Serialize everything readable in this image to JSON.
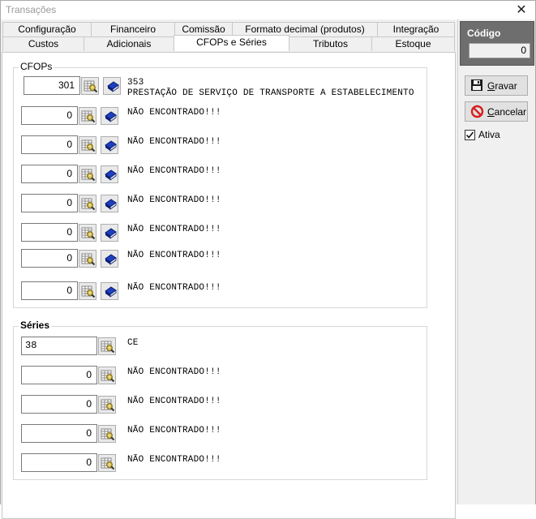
{
  "window": {
    "title": "Transações",
    "close_glyph": "✕"
  },
  "tabs": {
    "row1": [
      "Configuração",
      "Financeiro",
      "Comissão",
      "Formato decimal (produtos)",
      "Integração"
    ],
    "row2": [
      "Custos",
      "Adicionais",
      "CFOPs e Séries",
      "Tributos",
      "Estoque"
    ],
    "active": "CFOPs e Séries"
  },
  "cfops": {
    "label": "CFOPs",
    "rows": [
      {
        "value": "301",
        "line1": "353",
        "line2": "PRESTAÇÃO DE SERVIÇO DE TRANSPORTE A ESTABELECIMENTO"
      },
      {
        "value": "0",
        "line1": "NÃO ENCONTRADO!!!"
      },
      {
        "value": "0",
        "line1": "NÃO ENCONTRADO!!!"
      },
      {
        "value": "0",
        "line1": "NÃO ENCONTRADO!!!"
      },
      {
        "value": "0",
        "line1": "NÃO ENCONTRADO!!!"
      },
      {
        "value": "0",
        "line1": "NÃO ENCONTRADO!!!"
      },
      {
        "value": "0",
        "line1": "NÃO ENCONTRADO!!!"
      },
      {
        "value": "0",
        "line1": "NÃO ENCONTRADO!!!"
      }
    ]
  },
  "series": {
    "label": "Séries",
    "rows": [
      {
        "value": "38",
        "line1": "CE"
      },
      {
        "value": "0",
        "line1": "NÃO ENCONTRADO!!!"
      },
      {
        "value": "0",
        "line1": "NÃO ENCONTRADO!!!"
      },
      {
        "value": "0",
        "line1": "NÃO ENCONTRADO!!!"
      },
      {
        "value": "0",
        "line1": "NÃO ENCONTRADO!!!"
      }
    ]
  },
  "side": {
    "codigo_label": "Código",
    "codigo_value": "0",
    "gravar_label": "Gravar",
    "cancelar_label": "Cancelar",
    "ativa_label": "Ativa",
    "ativa_checked": true
  },
  "icons": {
    "search": "search-table-icon",
    "book": "blue-book-icon",
    "save": "floppy-disk-icon",
    "cancel": "cancel-circle-icon"
  },
  "colors": {
    "codigo_bg": "#6e6e6e",
    "book_blue": "#1e3fbf",
    "cancel_red": "#d81e1e"
  }
}
